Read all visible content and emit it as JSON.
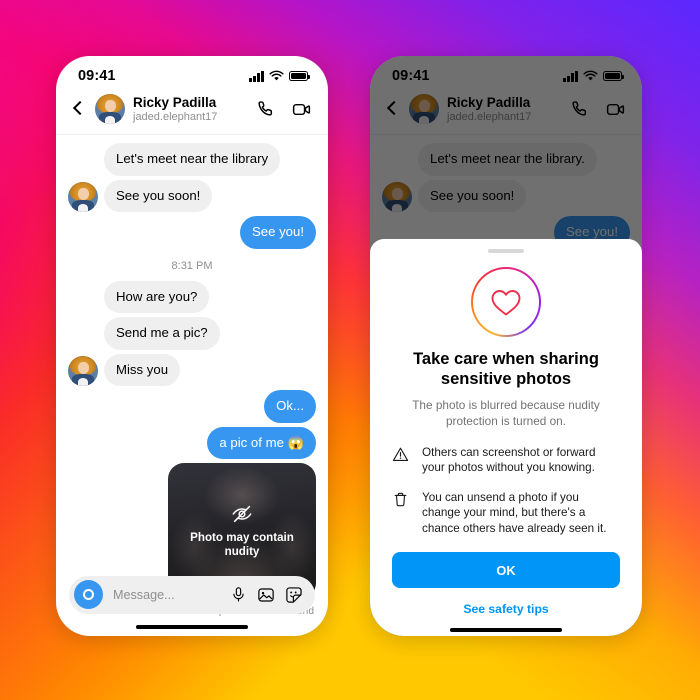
{
  "background": {
    "colors": [
      "#e000b8",
      "#fa2b28",
      "#ff8a00",
      "#ffc800",
      "#5a28ff",
      "#b014d2"
    ]
  },
  "phone_left": {
    "status": {
      "time": "09:41",
      "signal_icon": "signal-bars-icon",
      "wifi_icon": "wifi-icon",
      "battery_icon": "battery-icon"
    },
    "header": {
      "back_icon": "back-chevron-icon",
      "avatar_name": "avatar",
      "name": "Ricky Padilla",
      "username": "jaded.elephant17",
      "call_icon": "phone-call-icon",
      "video_icon": "video-camera-icon"
    },
    "messages": [
      {
        "id": "m1",
        "side": "them",
        "text": "Let's meet near the library",
        "avatar": false
      },
      {
        "id": "m2",
        "side": "them",
        "text": "See you soon!",
        "avatar": true
      },
      {
        "id": "m3",
        "side": "me",
        "text": "See you!"
      }
    ],
    "timestamp": "8:31 PM",
    "messages2": [
      {
        "id": "m4",
        "side": "them",
        "text": "How are you?",
        "avatar": false
      },
      {
        "id": "m5",
        "side": "them",
        "text": "Send me a pic?",
        "avatar": false
      },
      {
        "id": "m6",
        "side": "them",
        "text": "Miss you",
        "avatar": true
      },
      {
        "id": "m7",
        "side": "me",
        "text": "Ok..."
      },
      {
        "id": "m8",
        "side": "me",
        "text": "a pic of me 😱"
      }
    ],
    "photo": {
      "icon": "eye-slash-icon",
      "caption": "Photo may contain nudity",
      "unsend_hint": "Tap and hold to unsend"
    },
    "composer": {
      "camera_icon": "camera-circle-icon",
      "placeholder": "Message...",
      "mic_icon": "microphone-icon",
      "gallery_icon": "image-icon",
      "sticker_icon": "sticker-icon"
    }
  },
  "phone_right": {
    "status": {
      "time": "09:41"
    },
    "header": {
      "name": "Ricky Padilla",
      "username": "jaded.elephant17"
    },
    "messages": [
      {
        "id": "r1",
        "side": "them",
        "text": "Let's meet near the library.",
        "avatar": false
      },
      {
        "id": "r2",
        "side": "them",
        "text": "See you soon!",
        "avatar": true
      },
      {
        "id": "r3",
        "side": "me",
        "text": "See you!"
      }
    ],
    "sheet": {
      "grab_handle": "drag-handle",
      "hero_icon": "heart-in-gradient-ring-icon",
      "title": "Take care when sharing sensitive photos",
      "subtitle": "The photo is blurred because nudity protection is turned on.",
      "bullets": [
        {
          "icon": "warning-triangle-icon",
          "text": "Others can screenshot or forward your photos without you knowing."
        },
        {
          "icon": "trash-can-icon",
          "text": "You can unsend a photo if you change your mind, but there's a chance others have already seen it."
        }
      ],
      "ok_label": "OK",
      "ok_color": "#0095F6",
      "link_label": "See safety tips",
      "link_color": "#0095F6"
    }
  }
}
